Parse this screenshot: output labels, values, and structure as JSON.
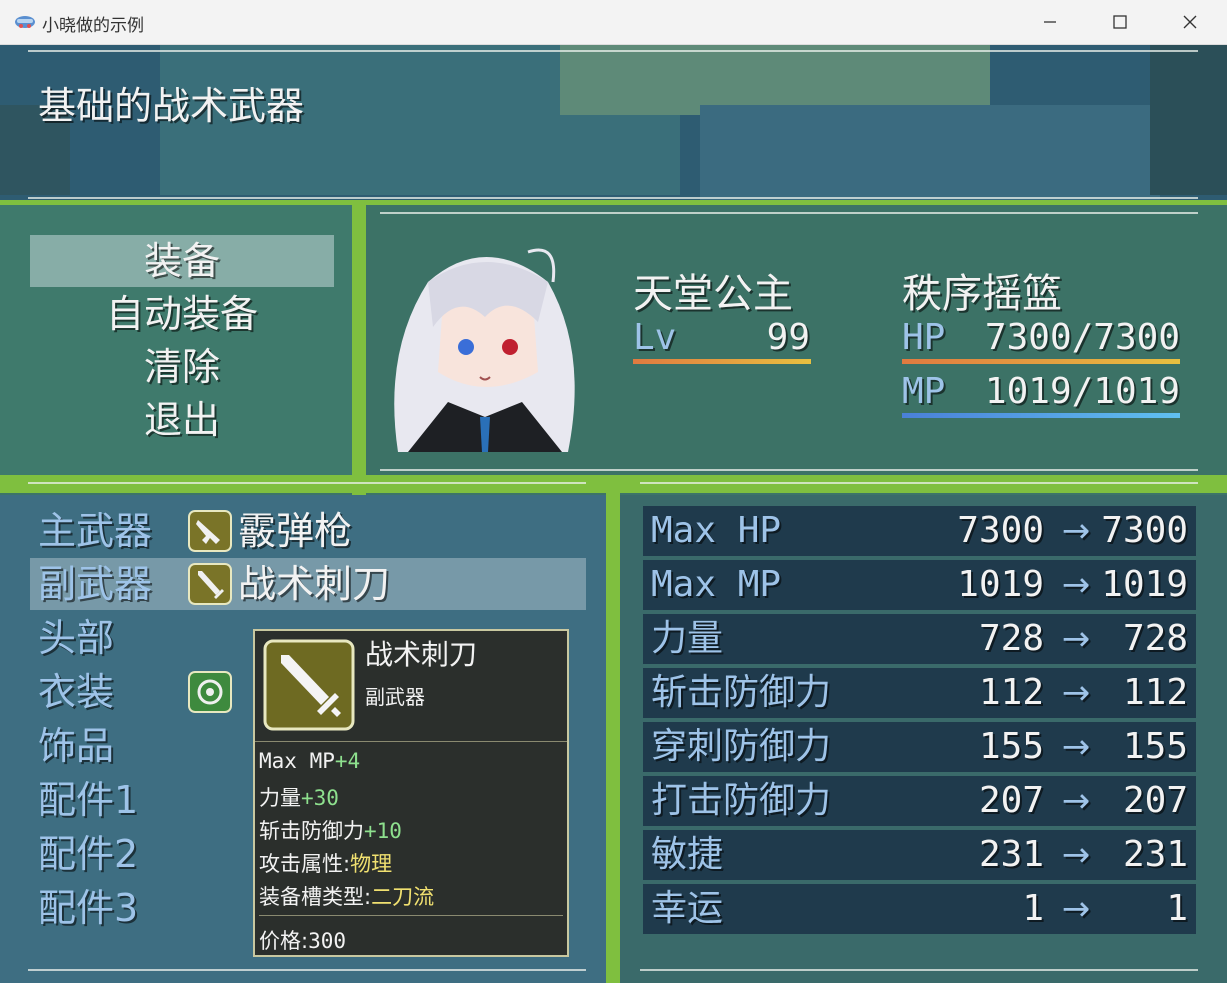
{
  "window": {
    "title": "小晓做的示例",
    "minimize_icon": "minimize-icon",
    "maximize_icon": "maximize-icon",
    "close_icon": "close-icon"
  },
  "help": {
    "text": "基础的战术武器"
  },
  "commands": [
    {
      "label": "装备",
      "selected": true
    },
    {
      "label": "自动装备",
      "selected": false
    },
    {
      "label": "清除",
      "selected": false
    },
    {
      "label": "退出",
      "selected": false
    }
  ],
  "actor": {
    "name": "天堂公主",
    "nickname": "秩序摇篮",
    "level_label": "Lv",
    "level": "99",
    "hp_label": "HP",
    "hp": "7300/7300",
    "hp_ratio": 1.0,
    "mp_label": "MP",
    "mp": "1019/1019",
    "mp_ratio": 1.0,
    "colors": {
      "hp_gauge": "#e0a040",
      "mp_gauge": "#58a8e8",
      "lv_gauge": "#e0a040"
    }
  },
  "slots": [
    {
      "label": "主武器",
      "item": "霰弹枪",
      "icon": "gun-icon",
      "selected": false
    },
    {
      "label": "副武器",
      "item": "战术刺刀",
      "icon": "sword-icon",
      "selected": true
    },
    {
      "label": "头部",
      "item": "",
      "icon": "",
      "selected": false
    },
    {
      "label": "衣装",
      "item": "",
      "icon": "armor-icon",
      "selected": false
    },
    {
      "label": "饰品",
      "item": "",
      "icon": "",
      "selected": false
    },
    {
      "label": "配件1",
      "item": "",
      "icon": "",
      "selected": false
    },
    {
      "label": "配件2",
      "item": "",
      "icon": "",
      "selected": false
    },
    {
      "label": "配件3",
      "item": "",
      "icon": "",
      "selected": false
    }
  ],
  "stats": [
    {
      "name": "Max HP",
      "old": "7300",
      "new": "7300"
    },
    {
      "name": "Max MP",
      "old": "1019",
      "new": "1019"
    },
    {
      "name": "力量",
      "old": "728",
      "new": "728"
    },
    {
      "name": "斩击防御力",
      "old": "112",
      "new": "112"
    },
    {
      "name": "穿刺防御力",
      "old": "155",
      "new": "155"
    },
    {
      "name": "打击防御力",
      "old": "207",
      "new": "207"
    },
    {
      "name": "敏捷",
      "old": "231",
      "new": "231"
    },
    {
      "name": "幸运",
      "old": "1",
      "new": "1"
    }
  ],
  "stat_arrow": "→",
  "tooltip": {
    "name": "战术刺刀",
    "type": "副武器",
    "icon": "sword-icon",
    "lines": [
      {
        "label": "Max MP",
        "value": "+4",
        "style": "green"
      },
      {
        "label": "力量",
        "value": "+30",
        "style": "green"
      },
      {
        "label": "斩击防御力",
        "value": "+10",
        "style": "green"
      },
      {
        "label": "攻击属性:",
        "value": "物理",
        "style": "yellow"
      },
      {
        "label": "装备槽类型:",
        "value": "二刀流",
        "style": "yellow"
      }
    ],
    "price_label": "价格:",
    "price": "300"
  }
}
